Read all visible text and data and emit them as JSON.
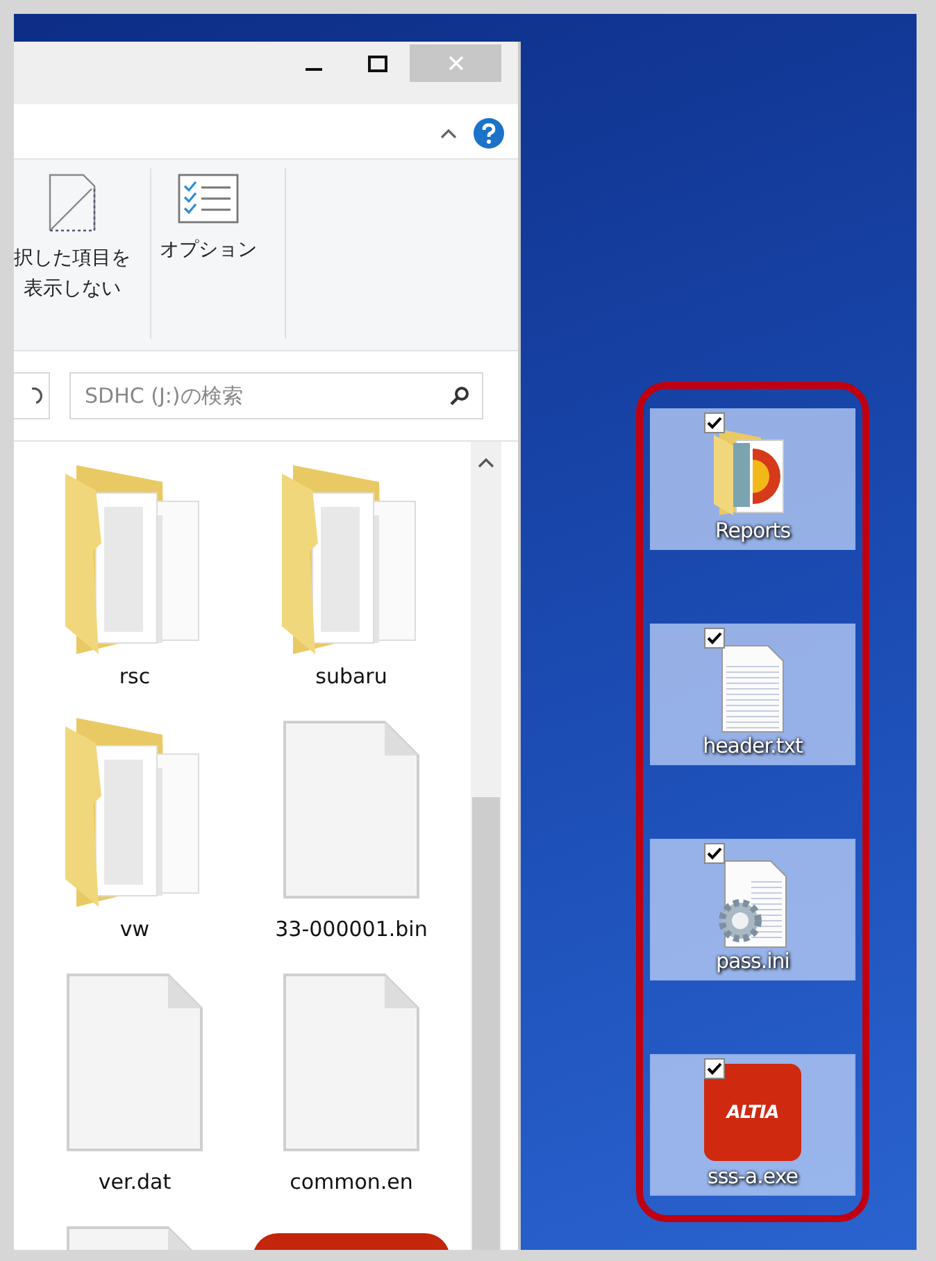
{
  "explorer": {
    "ribbon_buttons": [
      {
        "kind": "hide",
        "lines": [
          "択した項目を",
          "表示しない"
        ]
      },
      {
        "kind": "options",
        "lines": [
          "オプション"
        ]
      }
    ],
    "search": {
      "placeholder": "SDHC (J:)の検索"
    },
    "files": [
      {
        "kind": "folder",
        "name": "rsc"
      },
      {
        "kind": "folder",
        "name": "subaru"
      },
      {
        "kind": "folder",
        "name": "vw"
      },
      {
        "kind": "file",
        "name": "33-000001.bin"
      },
      {
        "kind": "file",
        "name": "ver.dat"
      },
      {
        "kind": "file",
        "name": "common.en"
      },
      {
        "kind": "file"
      },
      {
        "kind": "app"
      }
    ]
  },
  "desktop_icons": [
    {
      "kind": "folder",
      "name": "Reports",
      "checked": true,
      "selected": true
    },
    {
      "kind": "text",
      "name": "header.txt",
      "checked": true,
      "selected": true
    },
    {
      "kind": "ini",
      "name": "pass.ini",
      "checked": true,
      "selected": true
    },
    {
      "kind": "app",
      "name": "sss-a.exe",
      "logo": "ALTIA",
      "checked": true,
      "selected": true
    }
  ]
}
